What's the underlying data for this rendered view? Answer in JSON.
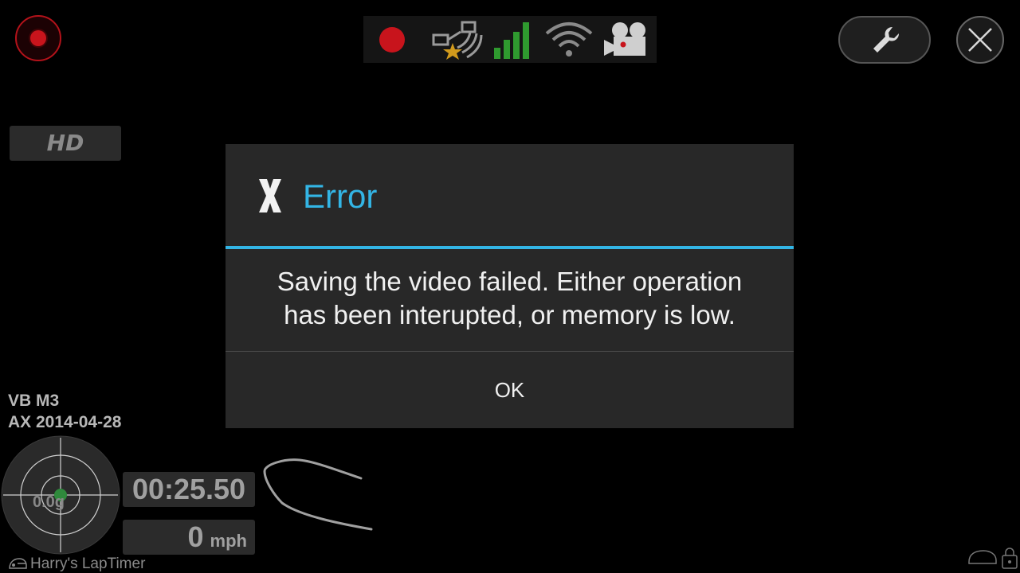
{
  "colors": {
    "accent": "#33b5e5",
    "record_red": "#c8141c",
    "signal_green": "#2f9a2f",
    "gauge_dot": "#2f8a3c",
    "star_gold": "#d19a1c"
  },
  "status_bar": {
    "icons": [
      "record-indicator-icon",
      "gps-satellite-icon",
      "signal-strength-icon",
      "wifi-icon",
      "video-camera-icon"
    ]
  },
  "hd_badge": "HD",
  "dialog": {
    "title": "Error",
    "message_line1": "Saving the video failed. Either operation",
    "message_line2": "has been interupted, or memory is low.",
    "ok_label": "OK"
  },
  "telemetry": {
    "track_line1": "VB M3",
    "track_line2": "AX 2014-04-28",
    "gforce": "0.0g",
    "lap_time": "00:25.50",
    "speed_value": "0",
    "speed_unit": "mph"
  },
  "app_name": "Harry's LapTimer"
}
